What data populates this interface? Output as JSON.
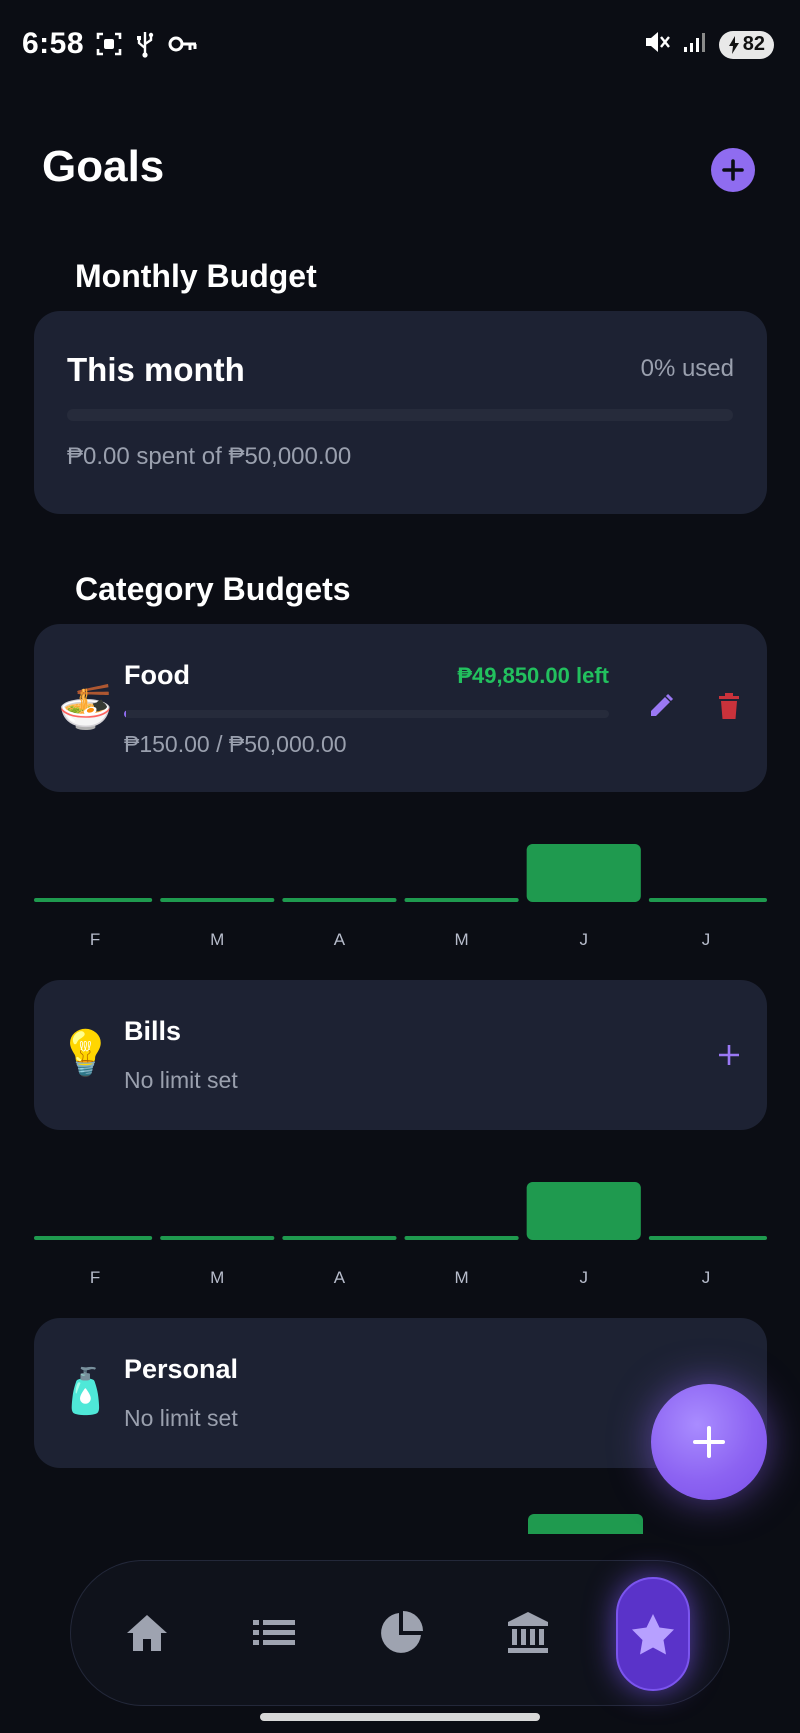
{
  "status_bar": {
    "time": "6:58",
    "battery": "82",
    "icons_left": [
      "screenshot-icon",
      "usb-icon",
      "key-icon"
    ],
    "icons_right": [
      "mute-icon",
      "signal-icon",
      "battery-icon"
    ]
  },
  "header": {
    "title": "Goals",
    "add_icon": "plus-icon"
  },
  "monthly_budget": {
    "section_title": "Monthly Budget",
    "card_title": "This month",
    "used_label": "0% used",
    "progress": 0,
    "spent_text": "₱0.00 spent of ₱50,000.00"
  },
  "category_budgets": {
    "section_title": "Category Budgets",
    "items": [
      {
        "emoji": "🍜",
        "name": "Food",
        "left_text": "₱49,850.00 left",
        "progress": 0.003,
        "sub_text": "₱150.00 / ₱50,000.00",
        "actions": [
          "edit-icon",
          "delete-icon"
        ]
      },
      {
        "emoji": "💡",
        "name": "Bills",
        "sub_text": "No limit set",
        "actions": [
          "plus-icon"
        ]
      },
      {
        "emoji": "🧴",
        "name": "Personal",
        "sub_text": "No limit set"
      }
    ]
  },
  "chart_data": [
    {
      "type": "bar",
      "categories": [
        "F",
        "M",
        "A",
        "M",
        "J",
        "J"
      ],
      "values": [
        0,
        0,
        0,
        0,
        1,
        0
      ],
      "highlight_color": "#1f9a4f"
    },
    {
      "type": "bar",
      "categories": [
        "F",
        "M",
        "A",
        "M",
        "J",
        "J"
      ],
      "values": [
        0,
        0,
        0,
        0,
        1,
        0
      ],
      "highlight_color": "#1f9a4f"
    }
  ],
  "fab": {
    "icon": "plus-icon"
  },
  "bottom_nav": {
    "items": [
      "home-icon",
      "list-icon",
      "pie-chart-icon",
      "bank-icon",
      "star-icon"
    ],
    "active": "star-icon"
  },
  "colors": {
    "accent": "#8f6cf0",
    "positive": "#22c05e",
    "danger": "#c9323b",
    "card": "#1d2233",
    "background": "#0b0d14"
  }
}
